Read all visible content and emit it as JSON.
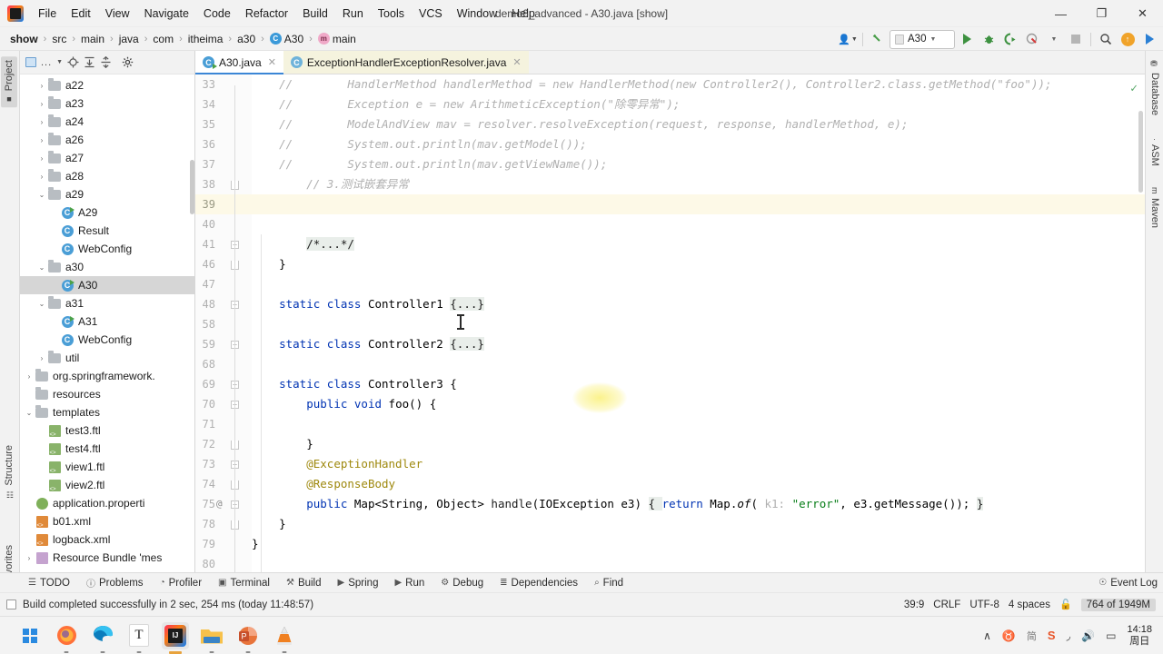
{
  "window": {
    "title": "demo6_advanced - A30.java [show]",
    "minimize": "—",
    "maximize": "❐",
    "close": "✕"
  },
  "menu": [
    {
      "label": "File"
    },
    {
      "label": "Edit"
    },
    {
      "label": "View"
    },
    {
      "label": "Navigate"
    },
    {
      "label": "Code"
    },
    {
      "label": "Refactor"
    },
    {
      "label": "Build"
    },
    {
      "label": "Run"
    },
    {
      "label": "Tools"
    },
    {
      "label": "VCS"
    },
    {
      "label": "Window"
    },
    {
      "label": "Help"
    }
  ],
  "breadcrumbs": [
    {
      "label": "show",
      "icon": "none",
      "bold": true
    },
    {
      "label": "src",
      "icon": "none",
      "bold": false
    },
    {
      "label": "main",
      "icon": "none",
      "bold": false
    },
    {
      "label": "java",
      "icon": "none",
      "bold": false
    },
    {
      "label": "com",
      "icon": "none",
      "bold": false
    },
    {
      "label": "itheima",
      "icon": "none",
      "bold": false
    },
    {
      "label": "a30",
      "icon": "none",
      "bold": false
    },
    {
      "label": "A30",
      "icon": "class",
      "bold": false
    },
    {
      "label": "main",
      "icon": "method",
      "bold": false
    }
  ],
  "breadcrumb_separator": "›",
  "main_toolbar": {
    "profile_icon": "user-profile-icon",
    "updates_icon": "hammer-build-icon",
    "run_config": "A30",
    "run_icon": "run-icon",
    "debug_icon": "debug-icon",
    "run_coverage_icon": "run-with-coverage-icon",
    "profiler_icon": "profiler-icon",
    "stop_icon": "stop-icon",
    "search_icon": "search-everywhere-icon",
    "update_project_icon": "update-project-icon",
    "next_icon": "next-icon"
  },
  "left_tool_tabs": [
    {
      "label": "Project",
      "icon": "project-icon",
      "active": true
    },
    {
      "label": "Structure",
      "icon": "structure-icon",
      "active": false
    },
    {
      "label": "Favorites",
      "icon": "star-icon",
      "active": false
    }
  ],
  "right_tool_tabs": [
    {
      "label": "Database",
      "icon": "database-icon"
    },
    {
      "label": "ASM",
      "icon": "asm-icon"
    },
    {
      "label": "Maven",
      "icon": "maven-icon"
    }
  ],
  "project_toolbar": {
    "scope_label": "...",
    "locate_icon": "locate-icon",
    "expand_icon": "expand-all-icon",
    "collapse_icon": "collapse-all-icon",
    "settings_icon": "gear-icon"
  },
  "project_tree": [
    {
      "label": "a22",
      "indent": 1,
      "arrow": "›",
      "icon": "folder",
      "selected": false
    },
    {
      "label": "a23",
      "indent": 1,
      "arrow": "›",
      "icon": "folder",
      "selected": false
    },
    {
      "label": "a24",
      "indent": 1,
      "arrow": "›",
      "icon": "folder",
      "selected": false
    },
    {
      "label": "a26",
      "indent": 1,
      "arrow": "›",
      "icon": "folder",
      "selected": false
    },
    {
      "label": "a27",
      "indent": 1,
      "arrow": "›",
      "icon": "folder",
      "selected": false
    },
    {
      "label": "a28",
      "indent": 1,
      "arrow": "›",
      "icon": "folder",
      "selected": false
    },
    {
      "label": "a29",
      "indent": 1,
      "arrow": "⌄",
      "icon": "folder",
      "selected": false
    },
    {
      "label": "A29",
      "indent": 2,
      "arrow": "",
      "icon": "class-runnable",
      "selected": false
    },
    {
      "label": "Result",
      "indent": 2,
      "arrow": "",
      "icon": "class",
      "selected": false
    },
    {
      "label": "WebConfig",
      "indent": 2,
      "arrow": "",
      "icon": "class",
      "selected": false
    },
    {
      "label": "a30",
      "indent": 1,
      "arrow": "⌄",
      "icon": "folder",
      "selected": false
    },
    {
      "label": "A30",
      "indent": 2,
      "arrow": "",
      "icon": "class-runnable",
      "selected": true
    },
    {
      "label": "a31",
      "indent": 1,
      "arrow": "⌄",
      "icon": "folder",
      "selected": false
    },
    {
      "label": "A31",
      "indent": 2,
      "arrow": "",
      "icon": "class-runnable",
      "selected": false
    },
    {
      "label": "WebConfig",
      "indent": 2,
      "arrow": "",
      "icon": "class",
      "selected": false
    },
    {
      "label": "util",
      "indent": 1,
      "arrow": "›",
      "icon": "folder",
      "selected": false
    },
    {
      "label": "org.springframework.",
      "indent": 0,
      "arrow": "›",
      "icon": "folder",
      "selected": false
    },
    {
      "label": "resources",
      "indent": 0,
      "arrow": "",
      "icon": "folder-resources",
      "selected": false
    },
    {
      "label": "templates",
      "indent": 0,
      "arrow": "⌄",
      "icon": "folder",
      "selected": false
    },
    {
      "label": "test3.ftl",
      "indent": 1,
      "arrow": "",
      "icon": "ftl",
      "selected": false
    },
    {
      "label": "test4.ftl",
      "indent": 1,
      "arrow": "",
      "icon": "ftl",
      "selected": false
    },
    {
      "label": "view1.ftl",
      "indent": 1,
      "arrow": "",
      "icon": "ftl",
      "selected": false
    },
    {
      "label": "view2.ftl",
      "indent": 1,
      "arrow": "",
      "icon": "ftl",
      "selected": false
    },
    {
      "label": "application.properti",
      "indent": 0,
      "arrow": "",
      "icon": "properties",
      "selected": false
    },
    {
      "label": "b01.xml",
      "indent": 0,
      "arrow": "",
      "icon": "xml",
      "selected": false
    },
    {
      "label": "logback.xml",
      "indent": 0,
      "arrow": "",
      "icon": "xml",
      "selected": false
    },
    {
      "label": "Resource Bundle 'mes",
      "indent": 0,
      "arrow": "›",
      "icon": "bundle",
      "selected": false
    }
  ],
  "editor_tabs": [
    {
      "label": "A30.java",
      "icon": "java-class-runnable-icon",
      "active": true,
      "modified": false
    },
    {
      "label": "ExceptionHandlerExceptionResolver.java",
      "icon": "java-library-class-icon",
      "active": false,
      "modified": true
    }
  ],
  "editor": {
    "inspection_ok_icon": "✓",
    "lines": [
      {
        "num": "33",
        "fold": "",
        "at": false,
        "current": false,
        "tokens": [
          {
            "t": "    ",
            "c": "plain"
          },
          {
            "t": "//",
            "c": "cmt"
          },
          {
            "t": "        HandlerMethod handlerMethod = new HandlerMethod(new Controller2(), Controller2.class.getMethod(\"foo\"));",
            "c": "cmt"
          }
        ]
      },
      {
        "num": "34",
        "fold": "",
        "at": false,
        "current": false,
        "tokens": [
          {
            "t": "    ",
            "c": "plain"
          },
          {
            "t": "//",
            "c": "cmt"
          },
          {
            "t": "        Exception e = new ArithmeticException(\"除零异常\");",
            "c": "cmt"
          }
        ]
      },
      {
        "num": "35",
        "fold": "",
        "at": false,
        "current": false,
        "tokens": [
          {
            "t": "    ",
            "c": "plain"
          },
          {
            "t": "//",
            "c": "cmt"
          },
          {
            "t": "        ModelAndView mav = resolver.resolveException(request, response, handlerMethod, e);",
            "c": "cmt"
          }
        ]
      },
      {
        "num": "36",
        "fold": "",
        "at": false,
        "current": false,
        "tokens": [
          {
            "t": "    ",
            "c": "plain"
          },
          {
            "t": "//",
            "c": "cmt"
          },
          {
            "t": "        System.out.println(mav.getModel());",
            "c": "cmt"
          }
        ]
      },
      {
        "num": "37",
        "fold": "",
        "at": false,
        "current": false,
        "tokens": [
          {
            "t": "    ",
            "c": "plain"
          },
          {
            "t": "//",
            "c": "cmt"
          },
          {
            "t": "        System.out.println(mav.getViewName());",
            "c": "cmt"
          }
        ]
      },
      {
        "num": "38",
        "fold": "end",
        "at": false,
        "current": false,
        "tokens": [
          {
            "t": "        // 3.测试嵌套异常",
            "c": "cmt"
          }
        ]
      },
      {
        "num": "39",
        "fold": "",
        "at": false,
        "current": true,
        "tokens": []
      },
      {
        "num": "40",
        "fold": "",
        "at": false,
        "current": false,
        "tokens": []
      },
      {
        "num": "41",
        "fold": "plus",
        "at": false,
        "current": false,
        "tokens": [
          {
            "t": "        ",
            "c": "plain"
          },
          {
            "t": "/*...*/",
            "c": "fld"
          }
        ]
      },
      {
        "num": "46",
        "fold": "end",
        "at": false,
        "current": false,
        "tokens": [
          {
            "t": "    }",
            "c": "plain"
          }
        ]
      },
      {
        "num": "47",
        "fold": "",
        "at": false,
        "current": false,
        "tokens": []
      },
      {
        "num": "48",
        "fold": "plus",
        "at": false,
        "current": false,
        "tokens": [
          {
            "t": "    ",
            "c": "plain"
          },
          {
            "t": "static",
            "c": "kw"
          },
          {
            "t": " ",
            "c": "plain"
          },
          {
            "t": "class",
            "c": "kw"
          },
          {
            "t": " Controller1 ",
            "c": "plain"
          },
          {
            "t": "{...}",
            "c": "fld"
          }
        ]
      },
      {
        "num": "58",
        "fold": "",
        "at": false,
        "current": false,
        "tokens": []
      },
      {
        "num": "59",
        "fold": "plus",
        "at": false,
        "current": false,
        "tokens": [
          {
            "t": "    ",
            "c": "plain"
          },
          {
            "t": "static",
            "c": "kw"
          },
          {
            "t": " ",
            "c": "plain"
          },
          {
            "t": "class",
            "c": "kw"
          },
          {
            "t": " Controller2 ",
            "c": "plain"
          },
          {
            "t": "{...}",
            "c": "fld"
          }
        ]
      },
      {
        "num": "68",
        "fold": "",
        "at": false,
        "current": false,
        "tokens": []
      },
      {
        "num": "69",
        "fold": "open",
        "at": false,
        "current": false,
        "tokens": [
          {
            "t": "    ",
            "c": "plain"
          },
          {
            "t": "static",
            "c": "kw"
          },
          {
            "t": " ",
            "c": "plain"
          },
          {
            "t": "class",
            "c": "kw"
          },
          {
            "t": " Controller3 {",
            "c": "plain"
          }
        ]
      },
      {
        "num": "70",
        "fold": "open",
        "at": false,
        "current": false,
        "tokens": [
          {
            "t": "        ",
            "c": "plain"
          },
          {
            "t": "public",
            "c": "kw"
          },
          {
            "t": " ",
            "c": "plain"
          },
          {
            "t": "void",
            "c": "kw"
          },
          {
            "t": " foo() {",
            "c": "plain"
          }
        ]
      },
      {
        "num": "71",
        "fold": "",
        "at": false,
        "current": false,
        "tokens": []
      },
      {
        "num": "72",
        "fold": "end",
        "at": false,
        "current": false,
        "tokens": [
          {
            "t": "        }",
            "c": "plain"
          }
        ]
      },
      {
        "num": "73",
        "fold": "open",
        "at": false,
        "current": false,
        "tokens": [
          {
            "t": "        ",
            "c": "plain"
          },
          {
            "t": "@ExceptionHandler",
            "c": "ann"
          }
        ]
      },
      {
        "num": "74",
        "fold": "end",
        "at": false,
        "current": false,
        "tokens": [
          {
            "t": "        ",
            "c": "plain"
          },
          {
            "t": "@ResponseBody",
            "c": "ann"
          }
        ]
      },
      {
        "num": "75",
        "fold": "plus",
        "at": true,
        "current": false,
        "tokens": [
          {
            "t": "        ",
            "c": "plain"
          },
          {
            "t": "public",
            "c": "kw"
          },
          {
            "t": " Map<String, Object> ",
            "c": "plain"
          },
          {
            "t": "handle",
            "c": "mth"
          },
          {
            "t": "(IOException e3) ",
            "c": "plain"
          },
          {
            "t": "{ ",
            "c": "fld"
          },
          {
            "t": "return",
            "c": "kw"
          },
          {
            "t": " Map.",
            "c": "plain"
          },
          {
            "t": "of",
            "c": "static-it"
          },
          {
            "t": "( ",
            "c": "plain"
          },
          {
            "t": "k1:",
            "c": "hint"
          },
          {
            "t": " ",
            "c": "plain"
          },
          {
            "t": "\"error\"",
            "c": "str"
          },
          {
            "t": ", e3.getMessage()); ",
            "c": "plain"
          },
          {
            "t": "}",
            "c": "fld"
          }
        ]
      },
      {
        "num": "78",
        "fold": "end",
        "at": false,
        "current": false,
        "tokens": [
          {
            "t": "    }",
            "c": "plain"
          }
        ]
      },
      {
        "num": "79",
        "fold": "",
        "at": false,
        "current": false,
        "tokens": [
          {
            "t": "}",
            "c": "plain"
          }
        ]
      },
      {
        "num": "80",
        "fold": "",
        "at": false,
        "current": false,
        "tokens": []
      }
    ]
  },
  "bottom_tool_bar": {
    "items": [
      {
        "label": "TODO",
        "icon": "todo-icon"
      },
      {
        "label": "Problems",
        "icon": "problems-icon"
      },
      {
        "label": "Profiler",
        "icon": "profiler-icon"
      },
      {
        "label": "Terminal",
        "icon": "terminal-icon"
      },
      {
        "label": "Build",
        "icon": "build-icon"
      },
      {
        "label": "Spring",
        "icon": "spring-icon"
      },
      {
        "label": "Run",
        "icon": "run-icon"
      },
      {
        "label": "Debug",
        "icon": "debug-icon"
      },
      {
        "label": "Dependencies",
        "icon": "dependencies-icon"
      },
      {
        "label": "Find",
        "icon": "find-icon"
      }
    ],
    "event_log": {
      "label": "Event Log",
      "icon": "event-log-icon"
    }
  },
  "status_bar": {
    "message": "Build completed successfully in 2 sec, 254 ms (today 11:48:57)",
    "caret_position": "39:9",
    "line_separator": "CRLF",
    "encoding": "UTF-8",
    "indent": "4 spaces",
    "lock_icon": "unlocked-icon",
    "memory": "764 of 1949M"
  },
  "taskbar": {
    "apps": [
      {
        "name": "windows-start-icon",
        "active": false
      },
      {
        "name": "firefox-icon",
        "active": false
      },
      {
        "name": "edge-icon",
        "active": false
      },
      {
        "name": "typora-icon",
        "active": false,
        "letter": "T"
      },
      {
        "name": "intellij-idea-icon",
        "active": true
      },
      {
        "name": "file-explorer-icon",
        "active": false
      },
      {
        "name": "powerpoint-icon",
        "active": false,
        "letter": "P"
      },
      {
        "name": "vlc-icon",
        "active": false
      }
    ],
    "tray": [
      {
        "name": "chevron-up-icon",
        "glyph": "∧"
      },
      {
        "name": "microphone-icon",
        "glyph": "♉"
      },
      {
        "name": "ime-icon",
        "glyph": "简"
      },
      {
        "name": "sogou-input-icon",
        "glyph": "S"
      },
      {
        "name": "wifi-icon",
        "glyph": "◞"
      },
      {
        "name": "volume-icon",
        "glyph": "🔊"
      },
      {
        "name": "battery-icon",
        "glyph": "▭"
      }
    ],
    "clock_time": "14:18",
    "clock_date": "周日"
  },
  "colors": {
    "accent_blue": "#3b86d6",
    "keyword": "#0033b3",
    "comment": "#b0b0b0",
    "annotation": "#9e880d",
    "string": "#067d17",
    "selection": "#d6d6d6",
    "current_line": "#fdf9e7"
  }
}
